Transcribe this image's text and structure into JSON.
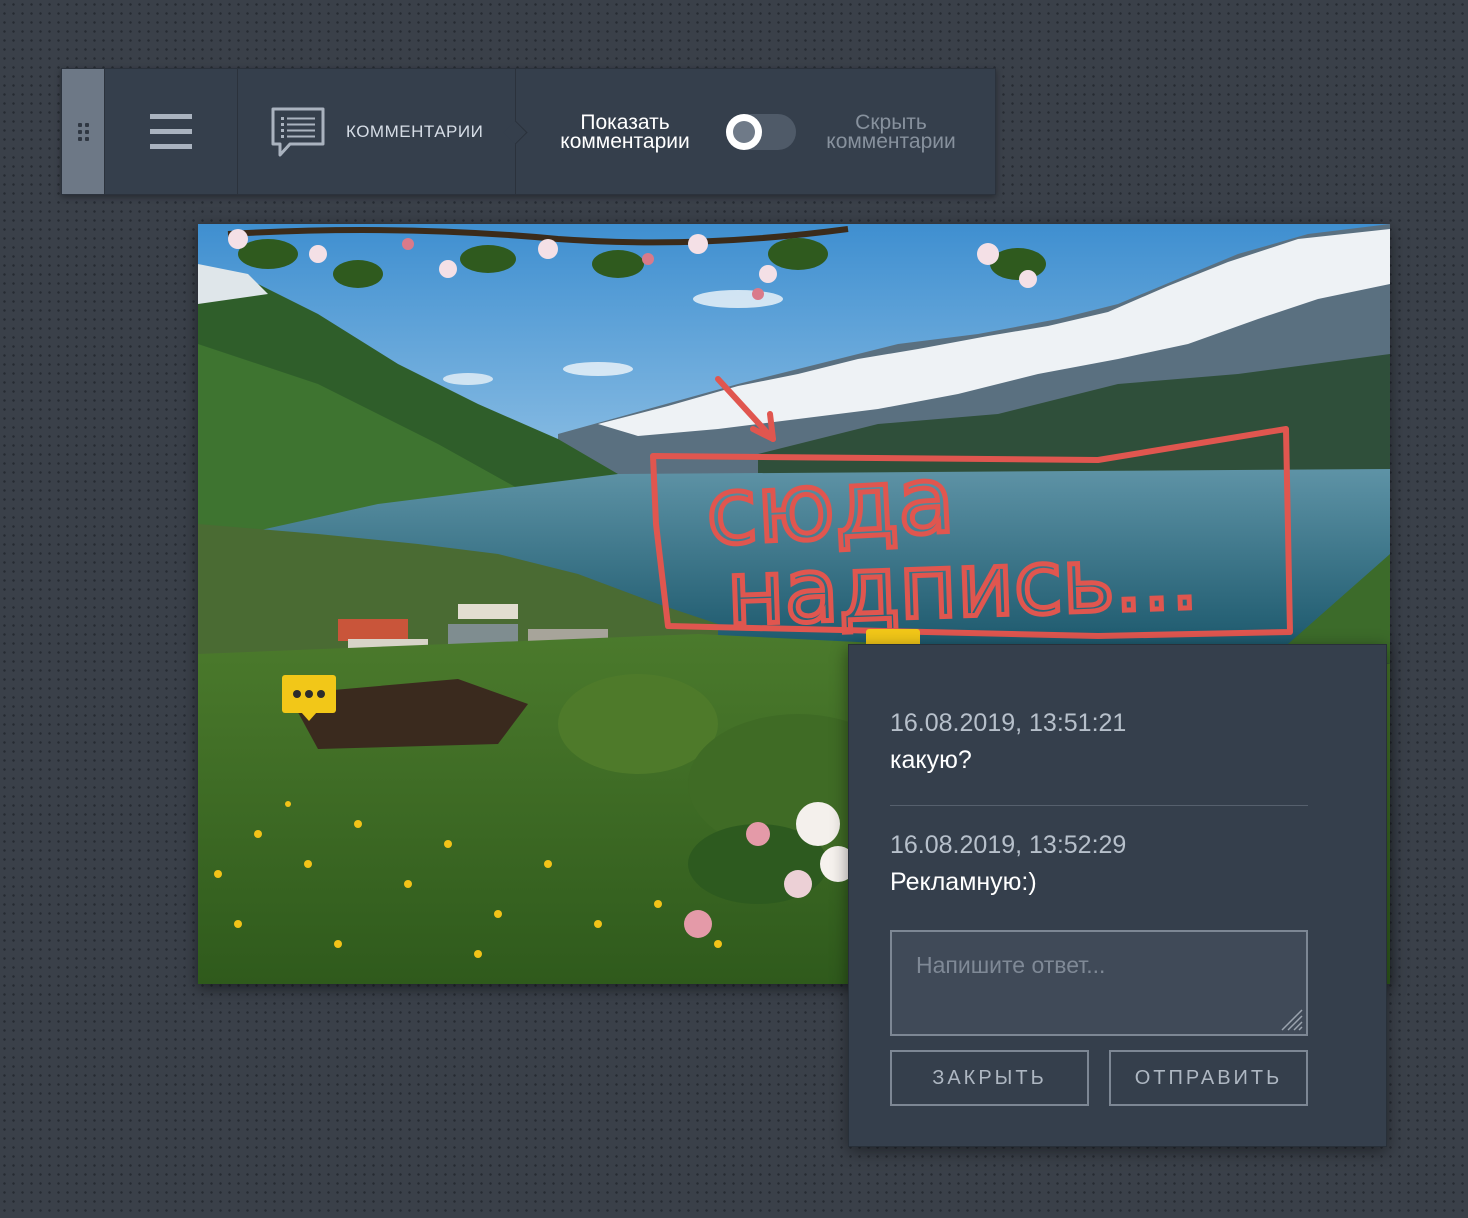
{
  "toolbar": {
    "comments_label": "КОММЕНТАРИИ",
    "show_comments_label": "Показать комментарии",
    "hide_comments_label": "Скрыть комментарии",
    "toggle_state": "show"
  },
  "image": {
    "annotation_text_line1": "сюда",
    "annotation_text_line2": "надпись..."
  },
  "markers": [
    {
      "icon": "comment-marker-icon"
    },
    {
      "icon": "comment-marker-icon"
    }
  ],
  "popup": {
    "comments": [
      {
        "time": "16.08.2019, 13:51:21",
        "text": "какую?"
      },
      {
        "time": "16.08.2019, 13:52:29",
        "text": "Рекламную:)"
      }
    ],
    "reply_placeholder": "Напишите ответ...",
    "close_label": "ЗАКРЫТЬ",
    "send_label": "ОТПРАВИТЬ"
  },
  "colors": {
    "background": "#3a4049",
    "panel": "#353f4c",
    "marker": "#f2c718",
    "annotation": "#e0564f"
  }
}
